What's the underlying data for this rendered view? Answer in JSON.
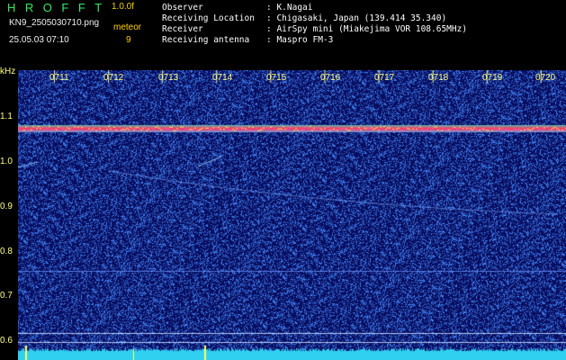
{
  "header": {
    "logo": "HROFFT",
    "version": "1.0.0f",
    "filename": "KN9_2505030710.png",
    "datetime": "25.05.03 07:10",
    "meteor_label": "meteor",
    "meteor_count": "9",
    "info": [
      {
        "key": "Observer",
        "value": ": K.Nagai"
      },
      {
        "key": "Receiving Location",
        "value": ": Chigasaki, Japan (139.414 35.340)"
      },
      {
        "key": "Receiver",
        "value": ": AirSpy mini (Miakejima VOR 108.65MHz)"
      },
      {
        "key": "Receiving antenna",
        "value": ": Maspro FM-3"
      }
    ]
  },
  "spectrogram": {
    "y_unit": "kHz",
    "y_ticks": [
      "1.1",
      "1.0",
      "0.9",
      "0.8",
      "0.7",
      "0.6"
    ],
    "x_ticks": [
      "0711",
      "0712",
      "0713",
      "0714",
      "0715",
      "0716",
      "0717",
      "0718",
      "0719",
      "0720"
    ],
    "colors": {
      "background": "#080e60",
      "noise": "#3a5ad8",
      "carrier": "#ff3060",
      "baseline": "#30d0f0",
      "labels": "#ffff80"
    }
  }
}
